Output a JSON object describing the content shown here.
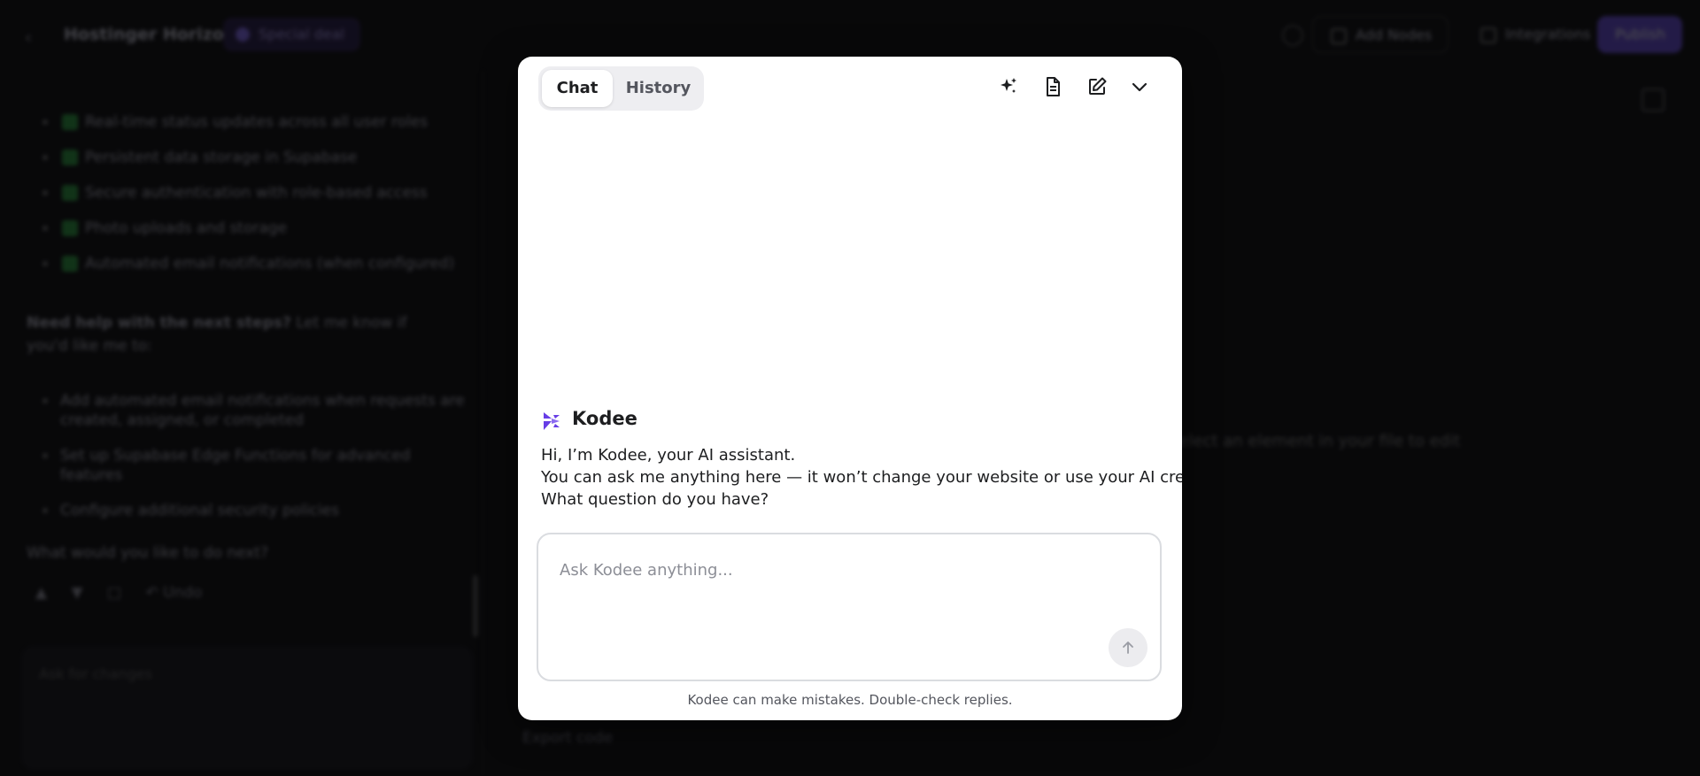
{
  "topbar": {
    "project_name": "Hostinger Horizons",
    "special_deal": "Special deal",
    "add_nodes": "Add Nodes",
    "integrations": "Integrations",
    "publish": "Publish"
  },
  "left_panel": {
    "checklist": [
      "Real-time status updates across all user roles",
      "Persistent data storage in Supabase",
      "Secure authentication with role-based access",
      "Photo uploads and storage",
      "Automated email notifications (when configured)"
    ],
    "help_bold": "Need help with the next steps?",
    "help_rest": " Let me know if you'd like me to:",
    "bullets": [
      "Add automated email notifications when requests are created, assigned, or completed",
      "Set up Supabase Edge Functions for advanced features",
      "Configure additional security policies"
    ],
    "question": "What would you like to do next?",
    "undo": "Undo",
    "input_placeholder": "Ask for changes"
  },
  "canvas": {
    "hint": "Select an element in your file to edit",
    "export": "Export code"
  },
  "modal": {
    "tabs": {
      "chat": "Chat",
      "history": "History"
    },
    "icons": [
      "sparkle-icon",
      "document-icon",
      "edit-icon",
      "chevron-down-icon"
    ],
    "assistant_name": "Kodee",
    "message_lines": [
      "Hi, I’m Kodee, your AI assistant.",
      "You can ask me anything here — it won’t change your website or use your AI credits.",
      "What question do you have?"
    ],
    "input_placeholder": "Ask Kodee anything...",
    "disclaimer": "Kodee can make mistakes. Double-check replies."
  },
  "colors": {
    "accent": "#673de6",
    "success": "#2ea043",
    "modal_bg": "#ffffff",
    "backdrop": "#0d0d0f"
  }
}
